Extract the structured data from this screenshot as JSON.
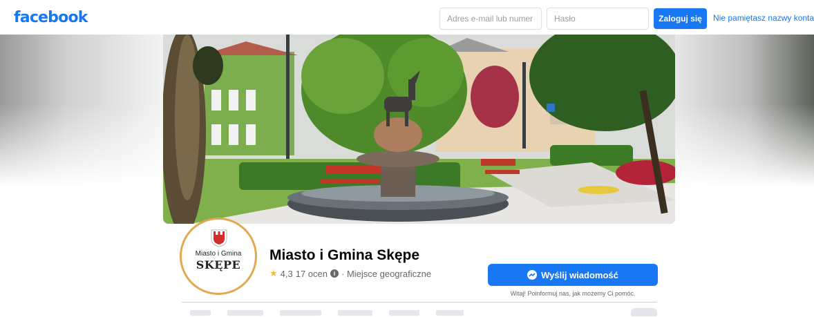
{
  "header": {
    "logo": "facebook",
    "email_placeholder": "Adres e-mail lub numer t",
    "password_placeholder": "Hasło",
    "login_label": "Zaloguj się",
    "forgot_label": "Nie pamiętasz nazwy konta?"
  },
  "profile": {
    "crest_line1": "Miasto i Gmina",
    "crest_line2": "SKĘPE",
    "name": "Miasto i Gmina Skępe",
    "rating": "4,3",
    "reviews": "17 ocen",
    "category": "· Miejsce geograficzne"
  },
  "actions": {
    "message_label": "Wyślij wiadomość",
    "message_hint": "Witaj! Poinformuj nas, jak możemy Ci pomóc."
  },
  "colors": {
    "brand": "#1877f2",
    "ring": "#e0a94f",
    "star": "#f7b928"
  },
  "icons": [
    "star-icon",
    "info-icon",
    "messenger-icon",
    "more-icon"
  ]
}
